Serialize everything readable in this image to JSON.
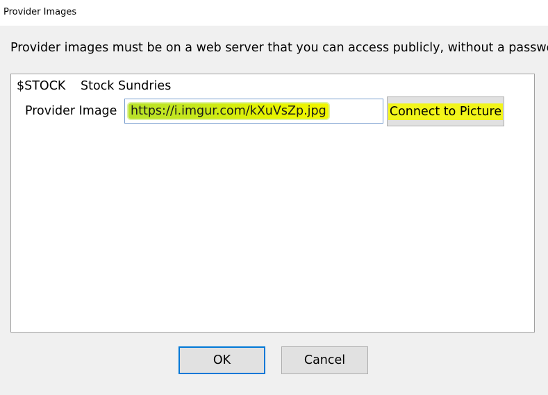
{
  "window": {
    "title": "Provider Images"
  },
  "notice": "Provider images must be on a web server that you can access publicly, without a password.",
  "record": {
    "code": "$STOCK",
    "name": "Stock Sundries"
  },
  "provider_image": {
    "label": "Provider Image",
    "value": "https://i.imgur.com/kXuVsZp.jpg",
    "highlight_color": "#e5f300"
  },
  "connect_button": {
    "label": "Connect to Picture"
  },
  "footer": {
    "ok_label": "OK",
    "cancel_label": "Cancel"
  },
  "colors": {
    "focus_border": "#0078d7",
    "button_face": "#e1e1e1",
    "dialog_background": "#f0f0f0"
  }
}
